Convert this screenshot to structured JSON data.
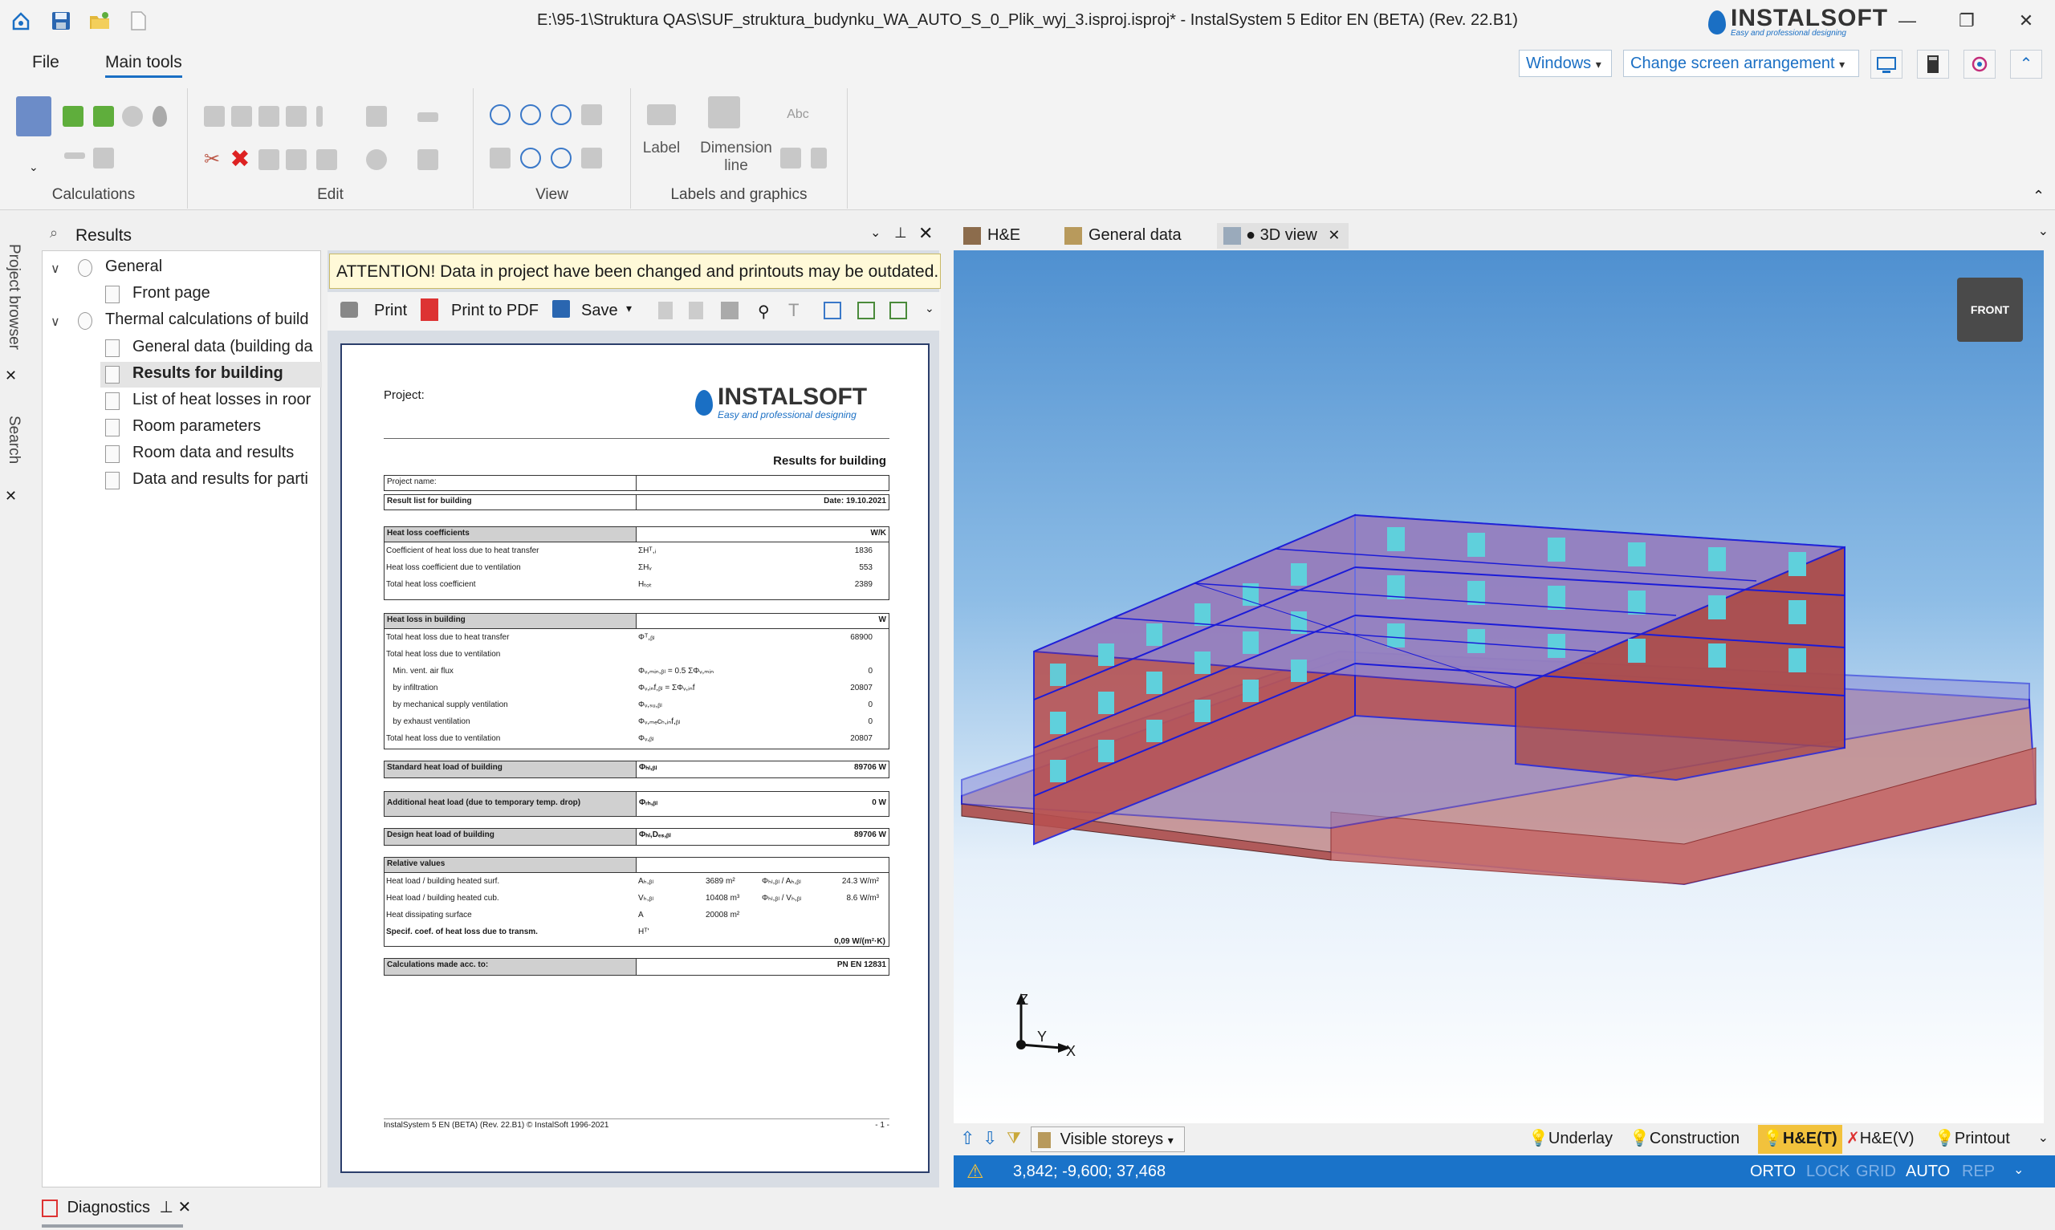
{
  "window": {
    "title": "E:\\95-1\\Struktura QAS\\SUF_struktura_budynku_WA_AUTO_S_0_Plik_wyj_3.isproj.isproj* - InstalSystem 5 Editor EN (BETA) (Rev. 22.B1)",
    "brand": "INSTALSOFT",
    "brand_tagline": "Easy and professional designing",
    "minimize": "—",
    "restore": "❐",
    "close": "✕"
  },
  "menu": {
    "file": "File",
    "main_tools": "Main tools",
    "windows": "Windows",
    "change_arrangement": "Change screen arrangement"
  },
  "ribbon": {
    "calculations": "Calculations",
    "edit": "Edit",
    "view": "View",
    "labels_graphics": "Labels and graphics",
    "label": "Label",
    "dimension_line": "Dimension line",
    "abc": "Abc"
  },
  "side_tabs": {
    "project_browser": "Project browser",
    "search": "Search"
  },
  "results_panel": {
    "title": "Results",
    "tree": [
      {
        "label": "General",
        "level": 0
      },
      {
        "label": "Front page",
        "level": 1
      },
      {
        "label": "Thermal calculations of build",
        "level": 0
      },
      {
        "label": "General data (building da",
        "level": 1
      },
      {
        "label": "Results for building",
        "level": 1,
        "selected": true
      },
      {
        "label": "List of heat losses in roor",
        "level": 1
      },
      {
        "label": "Room parameters",
        "level": 1
      },
      {
        "label": "Room data and results",
        "level": 1
      },
      {
        "label": "Data and results for parti",
        "level": 1
      }
    ]
  },
  "document": {
    "attention": "ATTENTION! Data in project have been changed and printouts may be outdated. Re",
    "print": "Print",
    "print_pdf": "Print to PDF",
    "save": "Save",
    "page": {
      "project_label": "Project:",
      "title": "Results for building",
      "project_name": "Project name:",
      "result_list": "Result list for building",
      "date": "Date:  19.10.2021",
      "coef_header": "Heat loss coefficients",
      "coef_unit": "W/K",
      "coef_rows": [
        {
          "label": "Coefficient of heat loss due to heat transfer",
          "sym": "ΣHᵀ,ᵢ",
          "val": "1836"
        },
        {
          "label": "Heat loss coefficient due to ventilation",
          "sym": "ΣHᵥ",
          "val": "553"
        },
        {
          "label": "Total heat loss coefficient",
          "sym": "Hₜₒₜ",
          "val": "2389"
        }
      ],
      "loss_header": "Heat loss in building",
      "loss_unit": "W",
      "loss_rows": [
        {
          "label": "Total heat loss due to heat transfer",
          "sym": "Φᵀ,ᵦₗ",
          "val": "68900"
        },
        {
          "label": "Total heat loss due to ventilation",
          "sym": "",
          "val": ""
        },
        {
          "label": "   Min. vent. air flux",
          "sym": "Φᵥ,ₘᵢₙ,ᵦₗ = 0.5 ΣΦᵥ,ₘᵢₙ",
          "val": "0"
        },
        {
          "label": "   by infiltration",
          "sym": "Φᵥ,ᵢₙf,ᵦₗ = ΣΦᵥ,ᵢₙf",
          "val": "20807"
        },
        {
          "label": "   by mechanical supply ventilation",
          "sym": "Φᵥ,ₛᵤ,ᵦₗ",
          "val": "0"
        },
        {
          "label": "   by exhaust ventilation",
          "sym": "Φᵥ,ₘₑcₕ,ᵢₙf,ᵦₗ",
          "val": "0"
        },
        {
          "label": "Total heat loss due to ventilation",
          "sym": "Φᵥ,ᵦₗ",
          "val": "20807"
        }
      ],
      "standard_label": "Standard heat load of building",
      "standard_sym": "Φₕₗ,ᵦₗ",
      "standard_val": "89706  W",
      "additional_label": "Additional heat load (due to temporary temp. drop)",
      "additional_sym": "Φᵣₕ,ᵦₗ",
      "additional_val": "0  W",
      "design_label": "Design heat load of building",
      "design_sym": "Φₕₗ,Dₑₛ,ᵦₗ",
      "design_val": "89706  W",
      "relative_header": "Relative values",
      "rel_rows": [
        {
          "label": "Heat load / building heated surf.",
          "sym": "Aₕ,ᵦₗ",
          "mid": "3689  m²",
          "sym2": "Φₕₗ,ᵦₗ / Aₕ,ᵦₗ",
          "val": "24.3  W/m²"
        },
        {
          "label": "Heat load / building heated cub.",
          "sym": "Vₕ,ᵦₗ",
          "mid": "10408  m³",
          "sym2": "Φₕₗ,ᵦₗ / Vₕ,ᵦₗ",
          "val": "8.6  W/m³"
        },
        {
          "label": "Heat dissipating surface",
          "sym": "A",
          "mid": "20008  m²",
          "sym2": "",
          "val": ""
        },
        {
          "label": "Specif. coef. of heat loss due to transm.",
          "sym": "Hᵀ'",
          "mid": "",
          "sym2": "",
          "val": "0,09  W/(m²·K)"
        }
      ],
      "calc_label": "Calculations made acc. to:",
      "calc_val": "PN EN 12831",
      "footer_left": "InstalSystem 5 EN (BETA) (Rev. 22.B1) © InstalSoft 1996-2021",
      "footer_right": "- 1 -"
    }
  },
  "view_tabs": {
    "he": "H&E",
    "general_data": "General data",
    "view3d": "● 3D view"
  },
  "view3d": {
    "navcube": "FRONT",
    "axis_z": "Z",
    "axis_y": "Y",
    "axis_x": "X"
  },
  "viewbar": {
    "visible_storeys": "Visible storeys",
    "underlay": "Underlay",
    "construction": "Construction",
    "het": "H&E(T)",
    "hev": "H&E(V)",
    "printout": "Printout"
  },
  "status": {
    "coords": "3,842; -9,600; 37,468",
    "orto": "ORTO",
    "lock": "LOCK",
    "grid": "GRID",
    "auto": "AUTO",
    "rep": "REP"
  },
  "diagnostics": "Diagnostics",
  "colors": {
    "accent": "#1a6fc4",
    "statusbar": "#1a73c9",
    "attention_bg": "#fff9d8",
    "building_wall": "#c44a4a",
    "building_edge": "#1b1bd8",
    "windows": "#5fd0dc"
  }
}
